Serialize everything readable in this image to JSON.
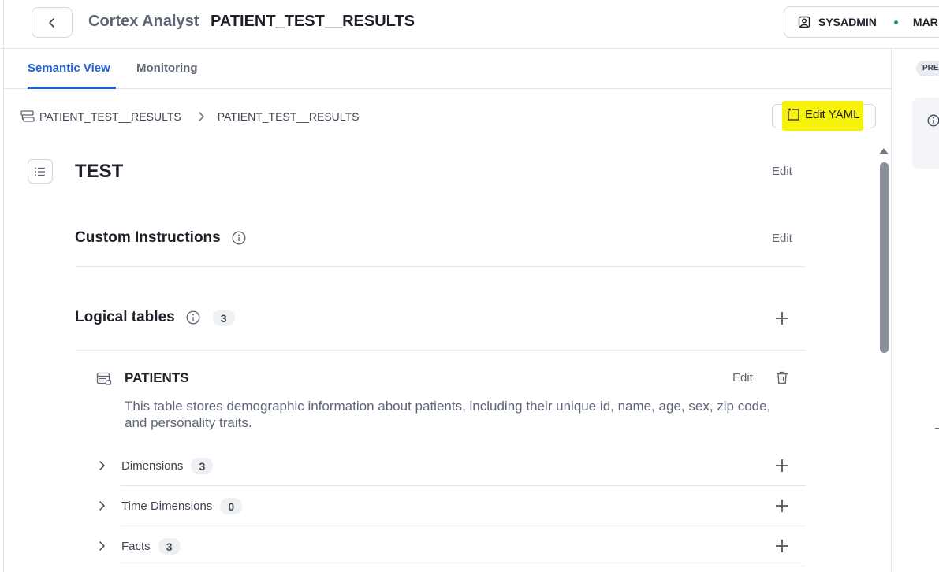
{
  "header": {
    "title_prefix": "Cortex Analyst",
    "title_main": "PATIENT_TEST__RESULTS",
    "role": "SYSADMIN",
    "warehouse": "MAR",
    "status_color": "#1a9c5b"
  },
  "tabs": [
    {
      "label": "Semantic View",
      "active": true
    },
    {
      "label": "Monitoring",
      "active": false
    }
  ],
  "right_panel": {
    "badge": "PRE"
  },
  "breadcrumb": {
    "items": [
      "PATIENT_TEST__RESULTS",
      "PATIENT_TEST__RESULTS"
    ]
  },
  "toolbar": {
    "edit_yaml_label": "Edit YAML",
    "highlight_color": "#f6f20c"
  },
  "semantic_view": {
    "name": "TEST",
    "edit_label": "Edit"
  },
  "custom_instructions": {
    "title": "Custom Instructions",
    "edit_label": "Edit"
  },
  "logical_tables": {
    "title": "Logical tables",
    "count": "3",
    "tables": [
      {
        "name": "PATIENTS",
        "edit_label": "Edit",
        "description": "This table stores demographic information about patients, including their unique id, name, age, sex, zip code, and personality traits.",
        "sections": [
          {
            "label": "Dimensions",
            "count": "3"
          },
          {
            "label": "Time Dimensions",
            "count": "0"
          },
          {
            "label": "Facts",
            "count": "3"
          }
        ]
      }
    ]
  },
  "icons": [
    "chevron-left-icon",
    "user-icon",
    "table-icon",
    "chevron-right-icon",
    "edit-file-icon",
    "list-icon",
    "info-icon",
    "plus-icon",
    "trash-icon"
  ],
  "colors": {
    "accent": "#1d62d6",
    "text_primary": "#1e2129",
    "text_secondary": "#5e6675"
  }
}
